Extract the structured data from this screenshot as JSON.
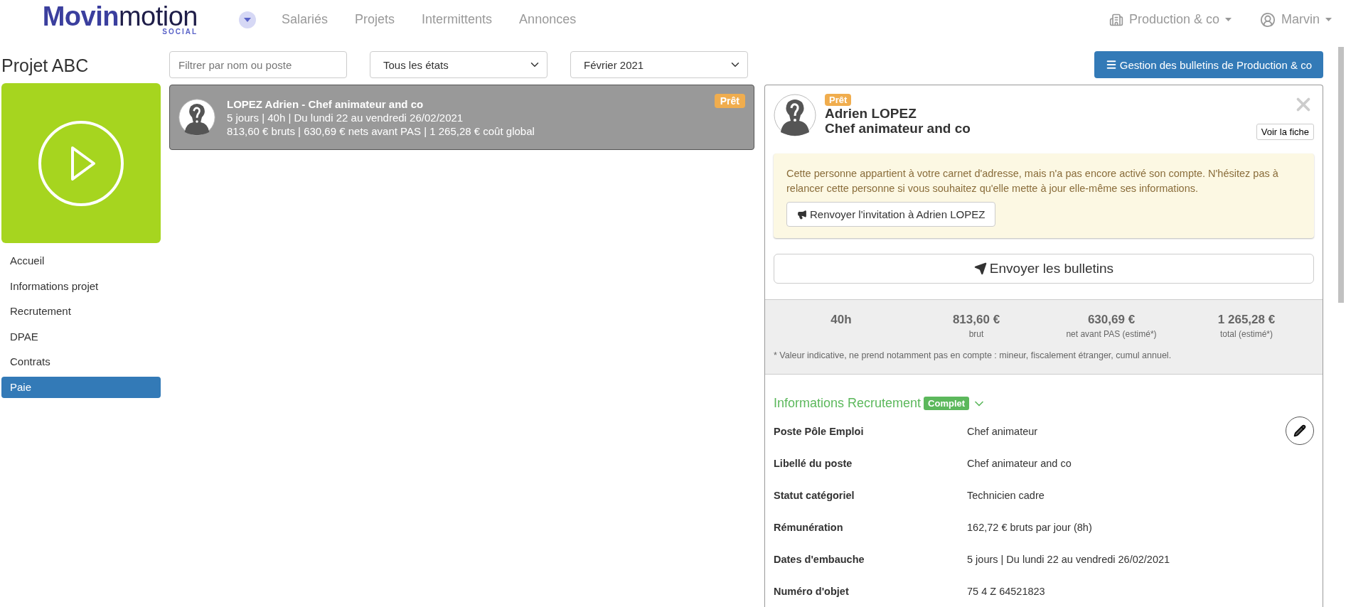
{
  "header": {
    "logo": "**Movin**motion",
    "tagline": "SOCIAL",
    "nav": [
      {
        "label": "Salariés",
        "selected": false
      },
      {
        "label": "Projets",
        "selected": false
      },
      {
        "label": "Intermittents",
        "selected": false
      },
      {
        "label": "Annonces",
        "selected": false
      }
    ],
    "company": "Production & co",
    "user": "Marvin"
  },
  "project": {
    "title": "Projet ABC",
    "menu": [
      {
        "label": "Accueil",
        "selected": false
      },
      {
        "label": "Informations projet",
        "selected": false
      },
      {
        "label": "Recrutement",
        "selected": false
      },
      {
        "label": "DPAE",
        "selected": false
      },
      {
        "label": "Contrats",
        "selected": false
      },
      {
        "label": "Paie",
        "selected": true
      }
    ]
  },
  "filters": {
    "search_placeholder": "Filtrer par nom ou poste",
    "state": "Tous les états",
    "month": "Février 2021"
  },
  "manage_button": "Gestion des bulletins de Production & co",
  "employees": [
    {
      "title": "LOPEZ Adrien - Chef animateur and co",
      "line_2": "5 jours | 40h | Du lundi 22 au vendredi 26/02/2021",
      "line_3": "813,60 € bruts | 630,69 € nets avant PAS | 1 265,28 € coût global",
      "status": "Prêt",
      "selected": true
    }
  ],
  "detail": {
    "status": "Prêt",
    "name": "Adrien LOPEZ",
    "role": "Chef animateur and co",
    "view_button": "Voir la fiche",
    "notice": "Cette personne appartient à votre carnet d'adresse, mais n'a pas encore activé son compte. N'hésitez pas à relancer cette personne si vous souhaitez qu'elle mette à jour elle-même ses informations.",
    "invite_button": "Renvoyer l'invitation à Adrien LOPEZ",
    "send_button": "Envoyer les bulletins",
    "stats": [
      {
        "value": "40h"
      },
      {
        "value": "813,60 €",
        "label": "brut"
      },
      {
        "value": "630,69 €",
        "label": "net avant PAS (estimé*)"
      },
      {
        "value": "1 265,28 €",
        "label": "total (estimé*)"
      }
    ],
    "footnote": "* Valeur indicative, ne prend notamment pas en compte : mineur, fiscalement étranger, cumul annuel.",
    "section": {
      "title": "Informations Recrutement",
      "badge": "Complet",
      "expanded": true,
      "fields": [
        {
          "label": "Poste Pôle Emploi",
          "value": "Chef animateur"
        },
        {
          "label": "Libellé du poste",
          "value": "Chef animateur and co"
        },
        {
          "label": "Statut catégoriel",
          "value": "Technicien cadre"
        },
        {
          "label": "Rémunération",
          "value": "162,72 € bruts par jour (8h)"
        },
        {
          "label": "Dates d'embauche",
          "value": "5 jours | Du lundi 22 au vendredi 26/02/2021"
        },
        {
          "label": "Numéro d'objet",
          "value": "75 4 Z 64521823"
        }
      ]
    }
  }
}
